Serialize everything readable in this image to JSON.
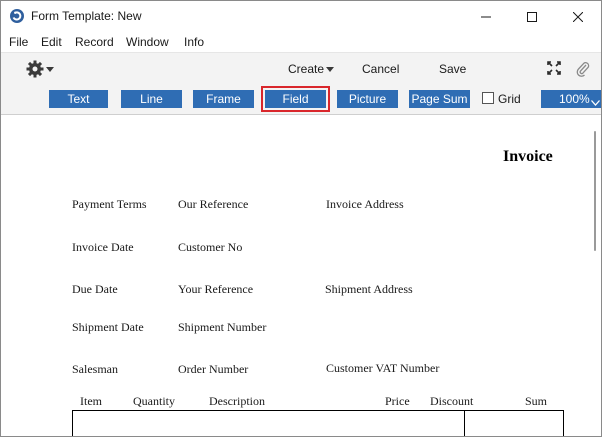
{
  "window": {
    "title": "Form Template: New"
  },
  "menu": [
    "File",
    "Edit",
    "Record",
    "Window",
    "Info"
  ],
  "toolbar": {
    "create_label": "Create",
    "cancel_label": "Cancel",
    "save_label": "Save"
  },
  "object_buttons": [
    {
      "label": "Text",
      "selected": false
    },
    {
      "label": "Line",
      "selected": false
    },
    {
      "label": "Frame",
      "selected": false
    },
    {
      "label": "Field",
      "selected": true
    },
    {
      "label": "Picture",
      "selected": false
    },
    {
      "label": "Page Sum",
      "selected": false
    }
  ],
  "grid": {
    "label": "Grid",
    "checked": false
  },
  "zoom": {
    "value": "100%"
  },
  "document": {
    "title": "Invoice",
    "fields": [
      "Payment Terms",
      "Our Reference",
      "Invoice Address",
      "Invoice Date",
      "Customer No",
      "Due Date",
      "Your Reference",
      "Shipment Address",
      "Shipment Date",
      "Shipment Number",
      "Salesman",
      "Order Number",
      "Customer VAT Number"
    ],
    "columns": [
      "Item",
      "Quantity",
      "Description",
      "Price",
      "Discount",
      "Sum"
    ]
  },
  "colors": {
    "button_blue": "#2f6db4",
    "selection_red": "#d9262b"
  }
}
